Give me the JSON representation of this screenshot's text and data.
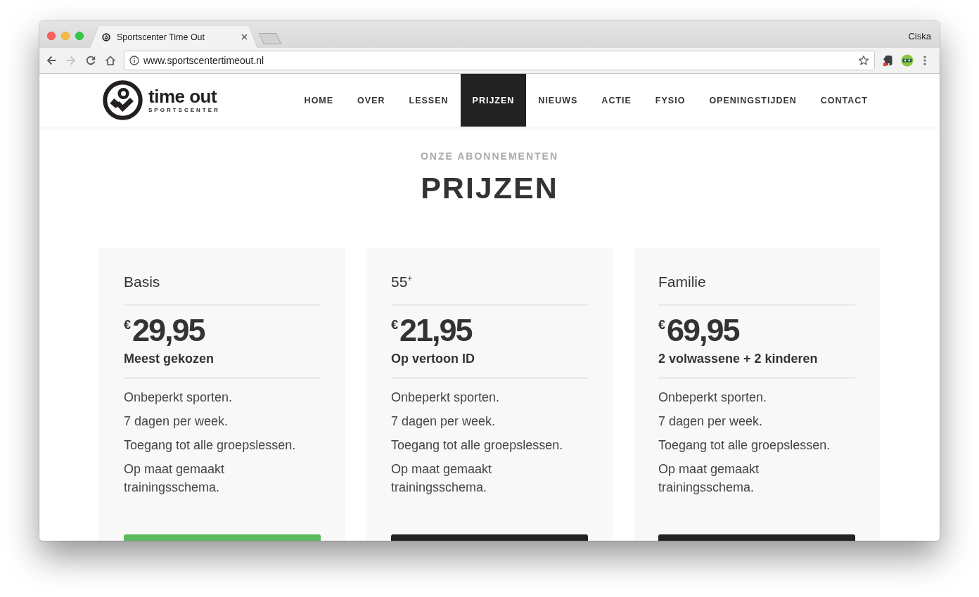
{
  "browser": {
    "tab_title": "Sportscenter Time Out",
    "profile": "Ciska",
    "url": "www.sportscentertimeout.nl",
    "nav_buttons": [
      {
        "kind": "back",
        "disabled": false
      },
      {
        "kind": "forward",
        "disabled": true
      },
      {
        "kind": "reload",
        "disabled": false
      },
      {
        "kind": "home",
        "disabled": false
      }
    ]
  },
  "site": {
    "logo_title": "time out",
    "logo_subtitle": "SPORTSCENTER",
    "nav": [
      {
        "label": "HOME",
        "selected": false
      },
      {
        "label": "OVER",
        "selected": false
      },
      {
        "label": "LESSEN",
        "selected": false
      },
      {
        "label": "PRIJZEN",
        "selected": true
      },
      {
        "label": "NIEUWS",
        "selected": false
      },
      {
        "label": "ACTIE",
        "selected": false
      },
      {
        "label": "FYSIO",
        "selected": false
      },
      {
        "label": "OPENINGSTIJDEN",
        "selected": false
      },
      {
        "label": "CONTACT",
        "selected": false
      }
    ]
  },
  "intro": {
    "eyebrow": "ONZE ABONNEMENTEN",
    "title": "PRIJZEN"
  },
  "plans": [
    {
      "title": "Basis",
      "price": "$^{€}$29,95",
      "note": "Meest gekozen",
      "features": [
        "Onbeperkt sporten.",
        "7 dagen per week.",
        "Toegang tot alle groepslessen.",
        "Op maat gemaakt trainingsschema."
      ],
      "button": {
        "color": "#5cb85c"
      }
    },
    {
      "title": "55$^{+}$",
      "price": "$^{€}$21,95",
      "note": "Op vertoon ID",
      "features": [
        "Onbeperkt sporten.",
        "7 dagen per week.",
        "Toegang tot alle groepslessen.",
        "Op maat gemaakt trainingsschema."
      ],
      "button": {
        "color": "#222222"
      }
    },
    {
      "title": "Familie",
      "price": "$^{€}$69,95",
      "note": "2 volwassene + 2 kinderen",
      "features": [
        "Onbeperkt sporten.",
        "7 dagen per week.",
        "Toegang tot alle groepslessen.",
        "Op maat gemaakt trainingsschema."
      ],
      "button": {
        "color": "#222222"
      }
    }
  ]
}
